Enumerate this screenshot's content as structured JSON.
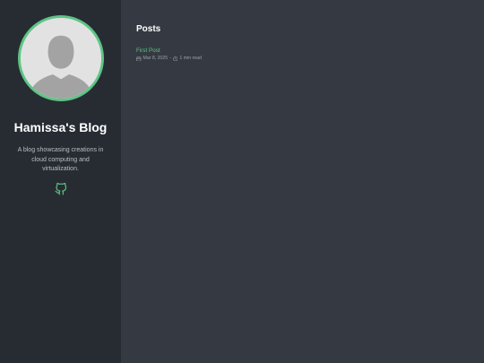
{
  "sidebar": {
    "title": "Hamissa's Blog",
    "description": "A blog showcasing creations in cloud computing and virtualization.",
    "github_icon": "github-icon",
    "avatar_icon": "default-user-avatar"
  },
  "main": {
    "section_title": "Posts",
    "posts": [
      {
        "title": "First Post",
        "date": "Mar 8, 2025",
        "reading_time": "1 min read",
        "date_icon": "calendar-icon",
        "time_icon": "clock-icon"
      }
    ]
  },
  "colors": {
    "accent": "#5ec484",
    "sidebar_bg": "#272c33",
    "main_bg": "#353a42"
  }
}
